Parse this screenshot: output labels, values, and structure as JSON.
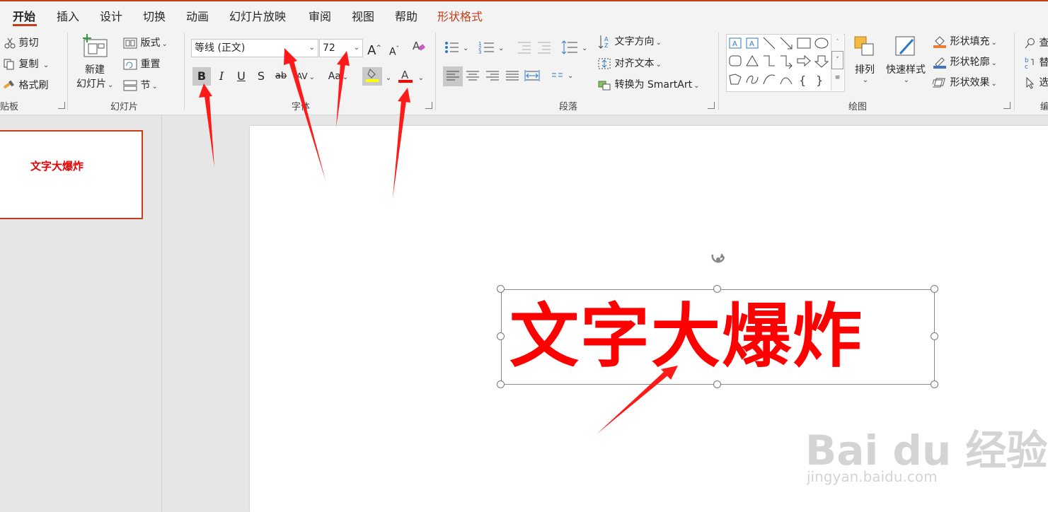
{
  "tabs": [
    {
      "label": "开始",
      "active": true
    },
    {
      "label": "插入"
    },
    {
      "label": "设计"
    },
    {
      "label": "切换"
    },
    {
      "label": "动画"
    },
    {
      "label": "幻灯片放映"
    },
    {
      "label": "审阅"
    },
    {
      "label": "视图"
    },
    {
      "label": "帮助"
    },
    {
      "label": "形状格式",
      "context": true
    }
  ],
  "clipboard": {
    "cut": "剪切",
    "copy": "复制",
    "painter": "格式刷",
    "group": "贴板"
  },
  "slides": {
    "new_slide_line1": "新建",
    "new_slide_line2": "幻灯片",
    "layout": "版式",
    "reset": "重置",
    "section": "节",
    "group": "幻灯片"
  },
  "font": {
    "name": "等线 (正文)",
    "size": "72",
    "bold": "B",
    "italic": "I",
    "underline": "U",
    "strike": "S",
    "strike2": "ab",
    "spacing": "AV",
    "case": "Aa",
    "grow": "A",
    "shrink": "A",
    "group": "字体"
  },
  "paragraph": {
    "text_direction": "文字方向",
    "align_text": "对齐文本",
    "smartart": "转换为 SmartArt",
    "group": "段落"
  },
  "drawing": {
    "arrange": "排列",
    "quick_styles": "快速样式",
    "fill": "形状填充",
    "outline": "形状轮廓",
    "effects": "形状效果",
    "group": "绘图"
  },
  "editing": {
    "find": "查",
    "replace": "替",
    "select": "选",
    "group": "编"
  },
  "slide": {
    "thumb_text": "文字大爆炸",
    "text": "文字大爆炸"
  },
  "watermark": {
    "line1": "Bai du 经验",
    "line2": "jingyan.baidu.com"
  },
  "colors": {
    "accent": "#c43e1c",
    "text_red": "#ff0000",
    "highlight": "#ffff00",
    "font_color_bar": "#ff0000"
  }
}
